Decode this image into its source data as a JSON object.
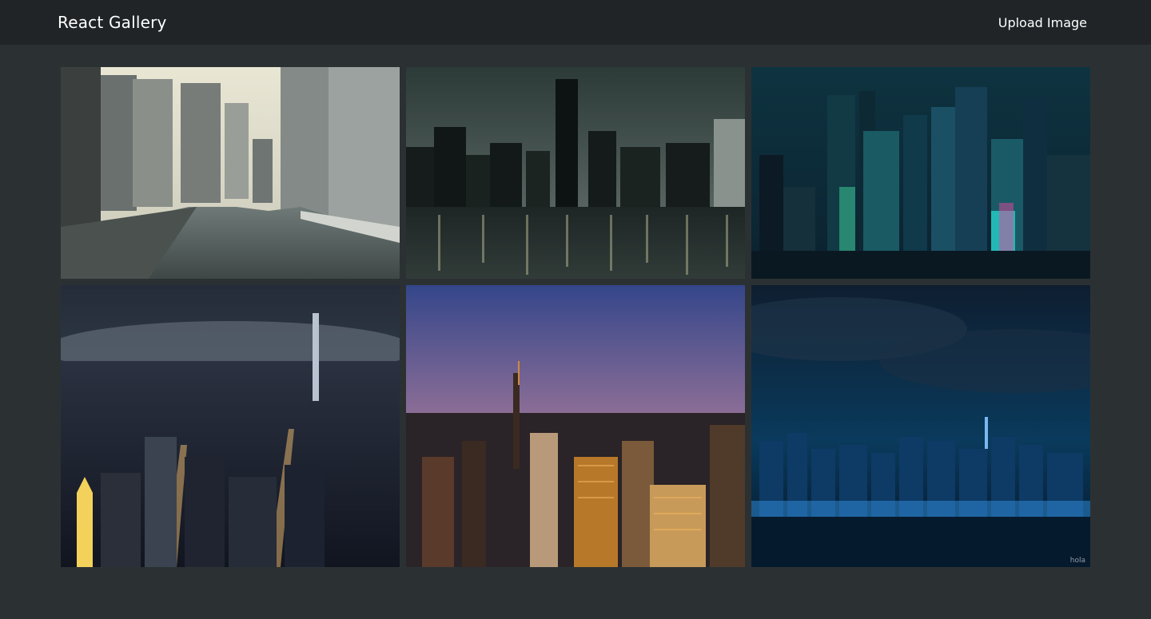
{
  "header": {
    "brand": "React Gallery",
    "upload_label": "Upload Image"
  },
  "gallery": {
    "images": [
      {
        "subject": "city-river-daytime-monochrome"
      },
      {
        "subject": "skyline-night-reflection-teal"
      },
      {
        "subject": "illustrated-neon-city-night"
      },
      {
        "subject": "aerial-city-night-fog"
      },
      {
        "subject": "skyline-sunset-aerial"
      },
      {
        "subject": "blue-skyline-night-waterfront",
        "watermark": "hola"
      }
    ]
  },
  "colors": {
    "navbar_bg": "#202427",
    "page_bg": "#2b3133",
    "text": "#ffffff"
  }
}
